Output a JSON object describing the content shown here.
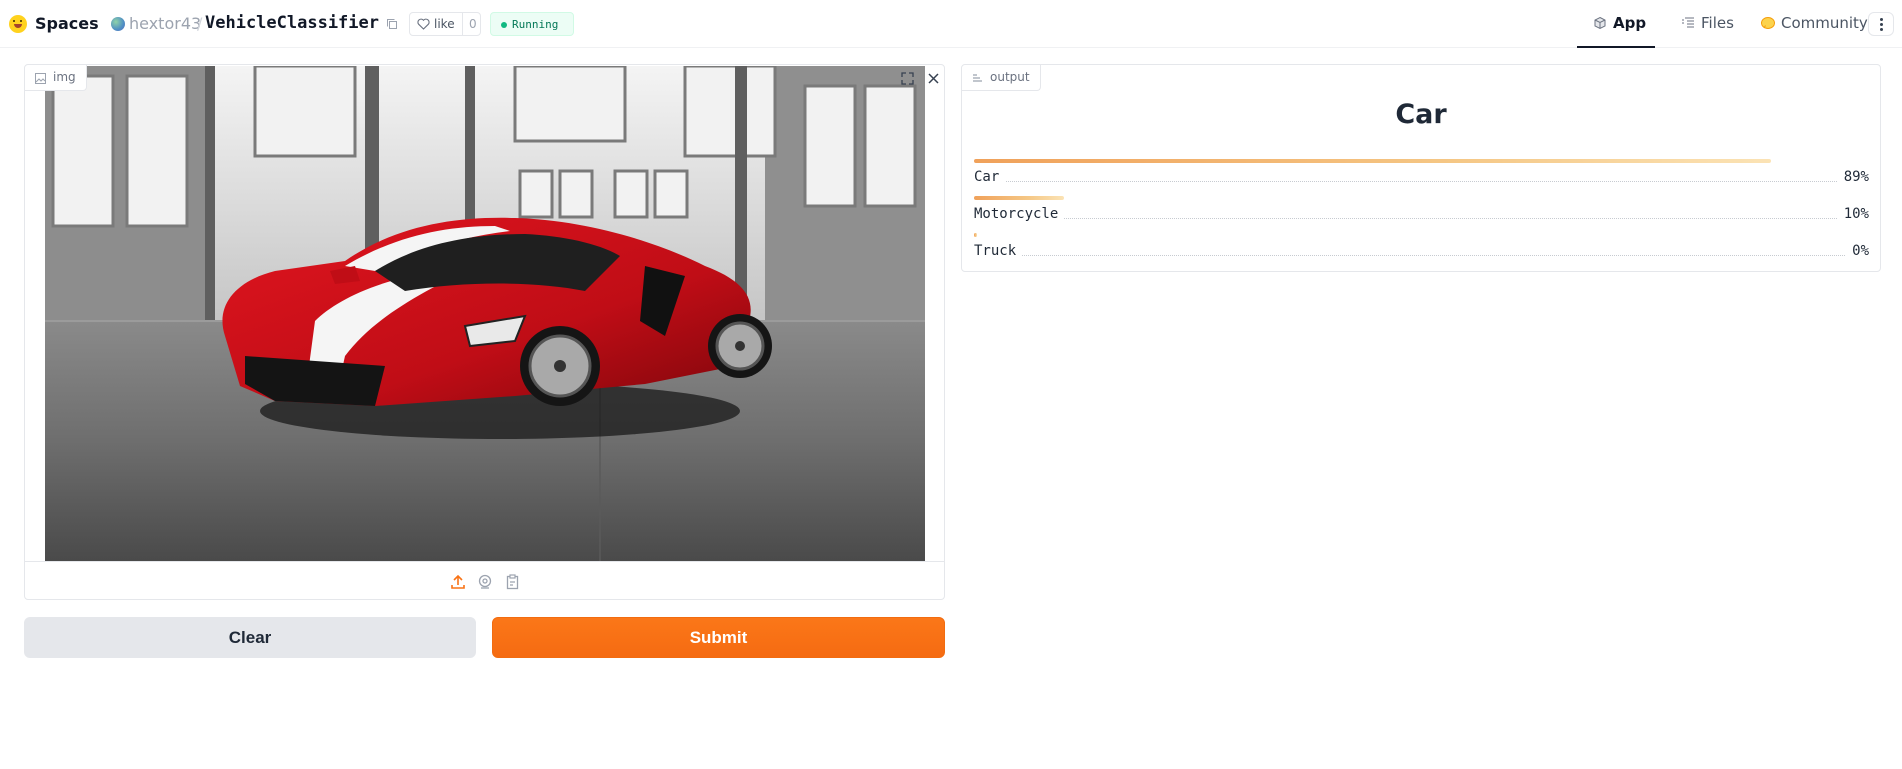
{
  "header": {
    "brand": "Spaces",
    "owner": "hextor43",
    "separator": "/",
    "repo": "VehicleClassifier",
    "like_label": "like",
    "like_count": "0",
    "status": "Running"
  },
  "nav": [
    {
      "label": "App",
      "icon": "cube-icon",
      "active": true
    },
    {
      "label": "Files",
      "icon": "files-icon",
      "active": false
    },
    {
      "label": "Community",
      "icon": "community-icon",
      "active": false
    }
  ],
  "input": {
    "label": "img",
    "image_description": "red sports car with white racing stripes in grey warehouse",
    "sources": [
      "upload-icon",
      "webcam-icon",
      "clipboard-icon"
    ]
  },
  "buttons": {
    "clear": "Clear",
    "submit": "Submit"
  },
  "output": {
    "label": "output",
    "top_label": "Car",
    "confidences": [
      {
        "label": "Car",
        "value": "89%",
        "fraction": 0.89
      },
      {
        "label": "Motorcycle",
        "value": "10%",
        "fraction": 0.1
      },
      {
        "label": "Truck",
        "value": "0%",
        "fraction": 0.0
      }
    ]
  },
  "colors": {
    "accent": "#f97316",
    "status_green": "#10b981",
    "bar_start": "#f0a15a",
    "bar_end": "#fbe3b5"
  }
}
